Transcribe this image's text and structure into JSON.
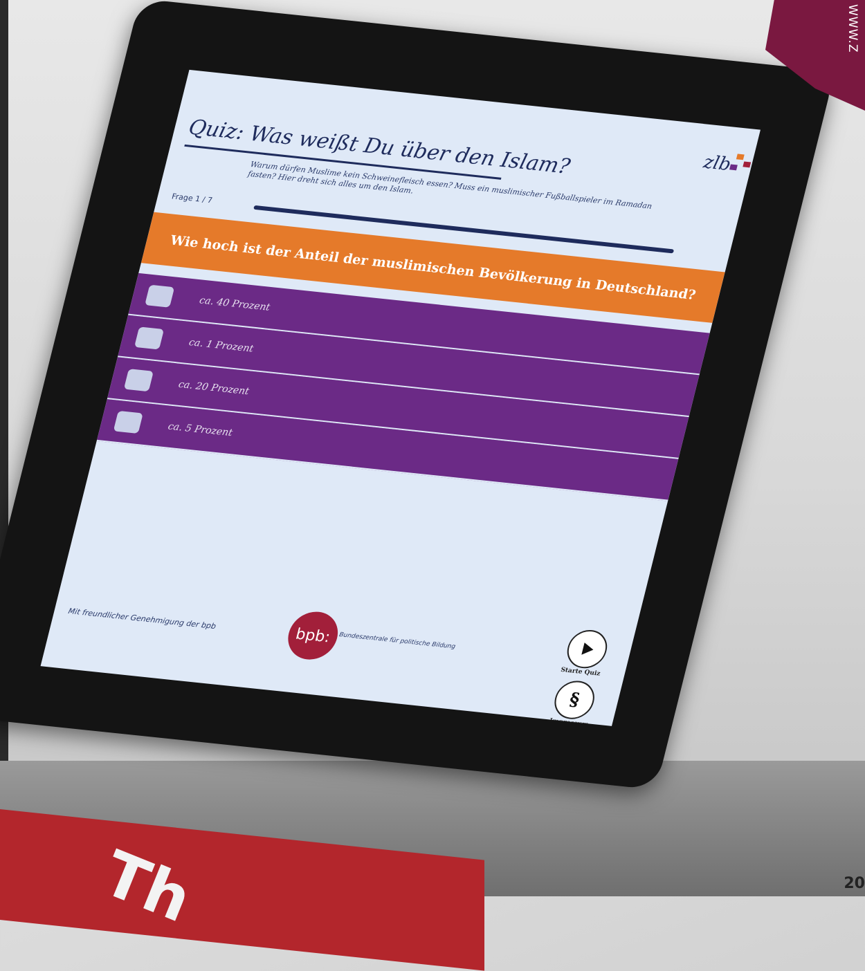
{
  "overlay": {
    "website_text": "WWW.Z",
    "page_number": "20",
    "sign_text": "Th"
  },
  "tablet": {
    "quiz_title": "Quiz: Was weißt Du über den Islam?",
    "logo_text": "zlb",
    "intro_text": "Warum dürfen Muslime kein Schweinefleisch essen? Muss ein muslimischer Fußballspieler im Ramadan fasten? Hier dreht sich alles um den Islam.",
    "progress_label": "Frage 1 / 7",
    "question": "Wie hoch ist der Anteil der muslimischen Bevölkerung in Deutschland?",
    "answers": [
      {
        "label": "ca. 40 Prozent"
      },
      {
        "label": "ca. 1 Prozent"
      },
      {
        "label": "ca. 20 Prozent"
      },
      {
        "label": "ca. 5 Prozent"
      }
    ],
    "footer_text": "Mit freundlicher Genehmigung der bpb",
    "bpb_logo": "bpb:",
    "bpb_name": "Bundeszentrale für politische Bildung",
    "start_quiz_label": "Starte Quiz",
    "impressum_label": "Impressum",
    "colors": {
      "question_bg": "#e57a2a",
      "answer_bg": "#6b2a86",
      "screen_bg": "#dfe9f7",
      "bpb_red": "#a21f3a"
    }
  }
}
